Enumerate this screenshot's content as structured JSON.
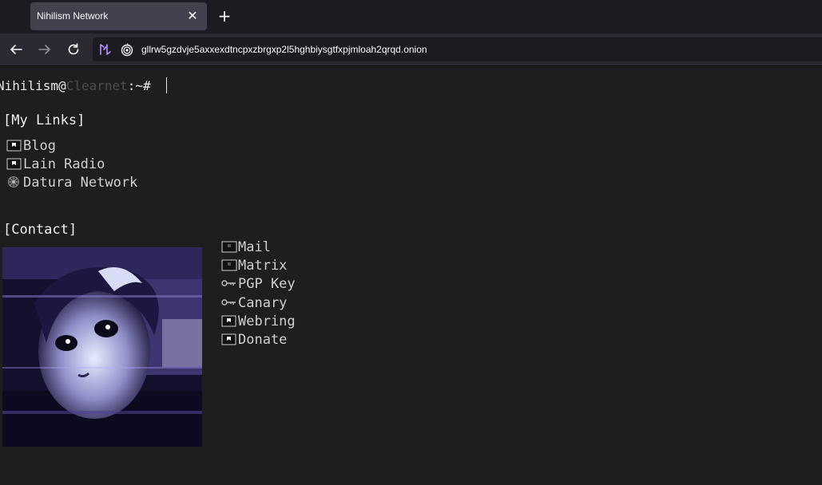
{
  "browser": {
    "tab_title": "Nihilism Network",
    "url": "gllrw5gzdvje5axxexdtncpxzbrgxp2l5hghbiysgtfxpjmloah2qrqd.onion"
  },
  "prompt": {
    "user": "Nihilism",
    "at": "@",
    "host": "Clearnet",
    "path": ":~# "
  },
  "my_links": {
    "heading": "[My Links]",
    "items": [
      {
        "label": "Blog",
        "icon": "flag-icon"
      },
      {
        "label": "Lain Radio",
        "icon": "flag-icon"
      },
      {
        "label": "Datura Network",
        "icon": "datura-flower-icon"
      }
    ]
  },
  "contact": {
    "heading": "[Contact]",
    "items": [
      {
        "label": "Mail",
        "icon": "mail-icon"
      },
      {
        "label": "Matrix",
        "icon": "matrix-icon"
      },
      {
        "label": "PGP Key",
        "icon": "key-icon"
      },
      {
        "label": "Canary",
        "icon": "key-icon"
      },
      {
        "label": "Webring",
        "icon": "flag-icon"
      },
      {
        "label": "Donate",
        "icon": "flag-icon"
      }
    ]
  },
  "colors": {
    "page_bg": "#1e1e1e",
    "text": "#e8e8e8",
    "host_dim": "#4e4e4e",
    "tab_bg": "#42414d",
    "toolbar_bg": "#2b2a33"
  }
}
